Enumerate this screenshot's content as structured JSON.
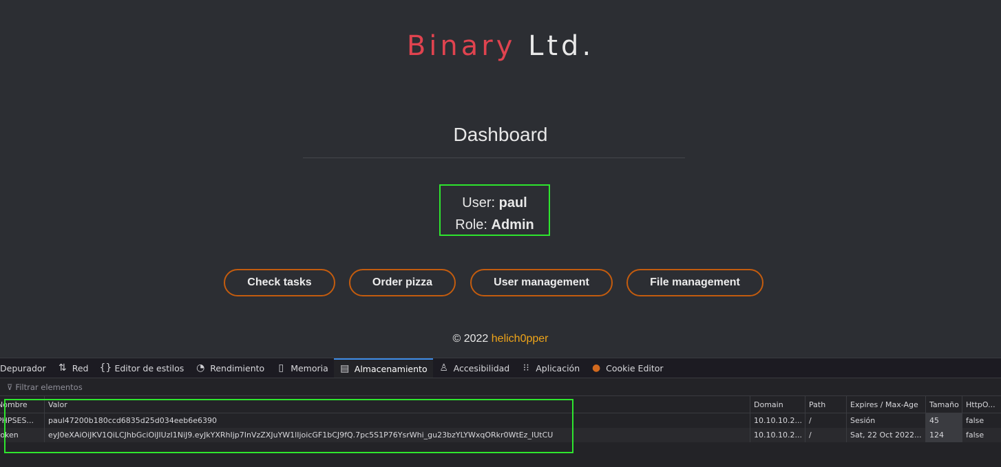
{
  "page": {
    "brand_part1": "Binary",
    "brand_part2": " Ltd.",
    "title": "Dashboard",
    "user_label": "User: ",
    "user_value": "paul",
    "role_label": "Role: ",
    "role_value": "Admin",
    "buttons": [
      {
        "label": "Check tasks"
      },
      {
        "label": "Order pizza"
      },
      {
        "label": "User management"
      },
      {
        "label": "File management"
      }
    ],
    "footer_copyright": "© 2022 ",
    "footer_author": "helich0pper"
  },
  "devtools": {
    "tabs": [
      {
        "label": "Depurador",
        "icon": "debugger-icon"
      },
      {
        "label": "Red",
        "icon": "network-icon"
      },
      {
        "label": "Editor de estilos",
        "icon": "braces-icon"
      },
      {
        "label": "Rendimiento",
        "icon": "gauge-icon"
      },
      {
        "label": "Memoria",
        "icon": "memory-icon"
      },
      {
        "label": "Almacenamiento",
        "icon": "storage-icon"
      },
      {
        "label": "Accesibilidad",
        "icon": "accessibility-icon"
      },
      {
        "label": "Aplicación",
        "icon": "grid-icon"
      },
      {
        "label": "Cookie Editor",
        "icon": "cookie-icon"
      }
    ],
    "active_tab": "Almacenamiento",
    "filter_placeholder": "Filtrar elementos",
    "columns": [
      "Nombre",
      "Valor",
      "Domain",
      "Path",
      "Expires / Max-Age",
      "Tamaño",
      "HttpO..."
    ],
    "rows": [
      [
        "PHPSES...",
        "paul47200b180ccd6835d25d034eeb6e6390",
        "10.10.10.2...",
        "/",
        "Sesión",
        "45",
        "false"
      ],
      [
        "token",
        "eyJ0eXAiOiJKV1QiLCJhbGciOiJIUzI1NiJ9.eyJkYXRhIjp7InVzZXJuYW1lIjoicGF1bCJ9fQ.7pc5S1P76YsrWhi_gu23bzYLYWxqORkr0WtEz_IUtCU",
        "10.10.10.2...",
        "/",
        "Sat, 22 Oct 2022...",
        "124",
        "false"
      ]
    ]
  },
  "colors": {
    "brand_red": "#e0434f",
    "button_border": "#c45c0e",
    "author": "#f0a519",
    "highlight_green": "#2ee62e",
    "active_tab": "#3d8dea"
  }
}
